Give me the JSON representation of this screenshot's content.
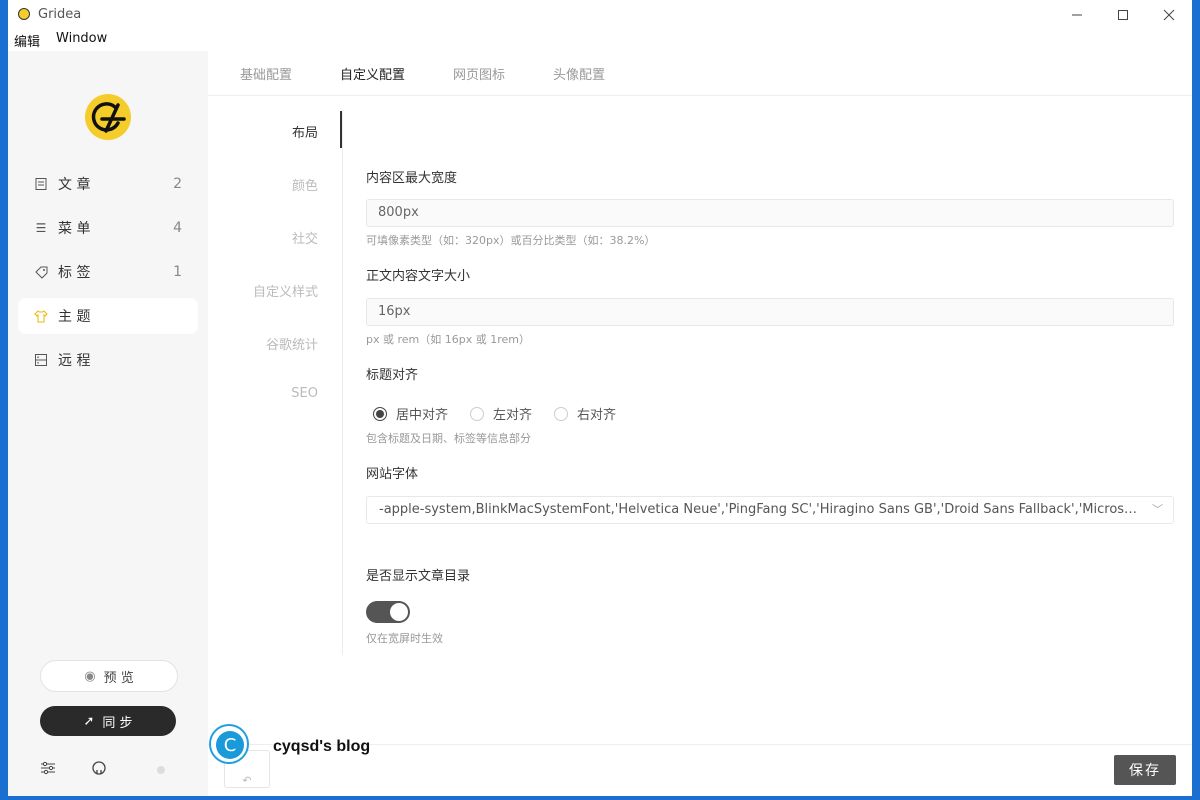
{
  "window": {
    "title": "Gridea"
  },
  "menubar": {
    "items": [
      "编辑",
      "Window"
    ]
  },
  "sidebar": {
    "items": [
      {
        "label": "文 章",
        "count": "2",
        "icon": "document-icon"
      },
      {
        "label": "菜 单",
        "count": "4",
        "icon": "menu-icon"
      },
      {
        "label": "标 签",
        "count": "1",
        "icon": "tag-icon"
      },
      {
        "label": "主 题",
        "count": "",
        "icon": "shirt-icon"
      },
      {
        "label": "远 程",
        "count": "",
        "icon": "server-icon"
      }
    ],
    "preview_label": "预 览",
    "sync_label": "同 步"
  },
  "tabs": [
    "基础配置",
    "自定义配置",
    "网页图标",
    "头像配置"
  ],
  "subnav": [
    "布局",
    "颜色",
    "社交",
    "自定义样式",
    "谷歌统计",
    "SEO"
  ],
  "form": {
    "content_width": {
      "label": "内容区最大宽度",
      "value": "800px",
      "hint": "可填像素类型（如：320px）或百分比类型（如：38.2%）"
    },
    "font_size": {
      "label": "正文内容文字大小",
      "value": "16px",
      "hint": "px 或 rem（如 16px 或 1rem）"
    },
    "title_align": {
      "label": "标题对齐",
      "options": [
        "居中对齐",
        "左对齐",
        "右对齐"
      ],
      "selected": "居中对齐",
      "hint": "包含标题及日期、标签等信息部分"
    },
    "site_font": {
      "label": "网站字体",
      "value": "-apple-system,BlinkMacSystemFont,'Helvetica Neue','PingFang SC','Hiragino Sans GB','Droid Sans Fallback','Microsoft YaHei',sans-serif"
    },
    "show_toc": {
      "label": "是否显示文章目录",
      "hint": "仅在宽屏时生效",
      "enabled": true
    }
  },
  "footer": {
    "save_label": "保存"
  },
  "watermark": {
    "letter": "C",
    "text": "cyqsd's blog"
  },
  "colors": {
    "accent": "#333333",
    "logo_yellow": "#f4cd2a",
    "save_button": "#555555",
    "desktop": "#1a6fd0"
  }
}
